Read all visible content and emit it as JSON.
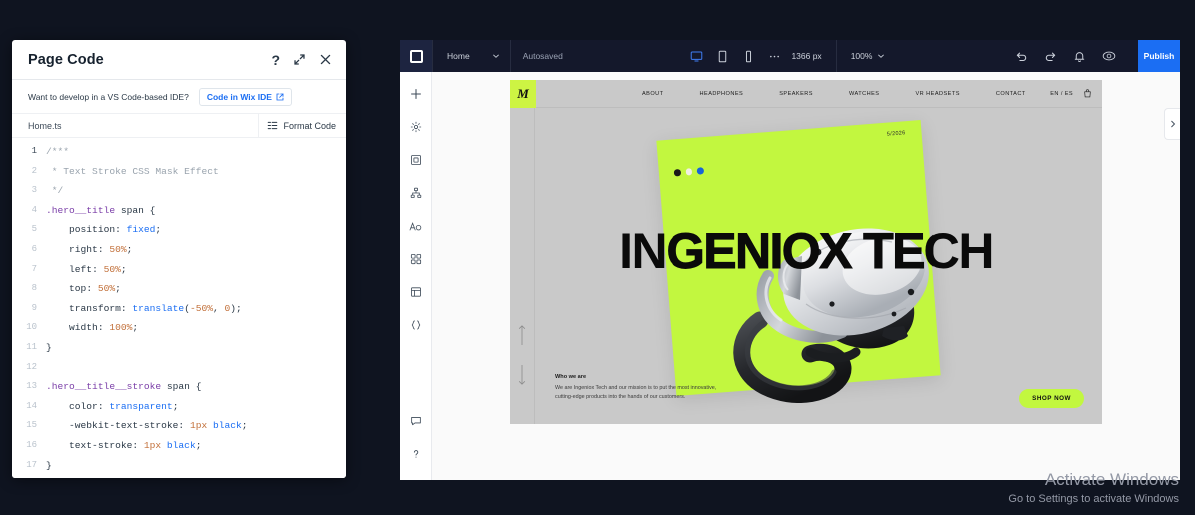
{
  "code_panel": {
    "title": "Page Code",
    "actions": [
      {
        "name": "help-icon",
        "label": "?"
      },
      {
        "name": "expand-icon",
        "label": "expand"
      },
      {
        "name": "close-icon",
        "label": "close"
      }
    ],
    "promo_text": "Want to develop in a VS Code-based IDE?",
    "ide_button_label": "Code in Wix IDE",
    "tab_label": "Home.ts",
    "format_label": "Format Code",
    "lines": [
      {
        "n": "1",
        "active": true,
        "tokens": [
          {
            "t": "/***",
            "c": "k-com"
          }
        ]
      },
      {
        "n": "2",
        "active": false,
        "tokens": [
          {
            "t": " * Text Stroke CSS Mask Effect",
            "c": "k-com"
          }
        ]
      },
      {
        "n": "3",
        "active": false,
        "tokens": [
          {
            "t": " */",
            "c": "k-com"
          }
        ]
      },
      {
        "n": "4",
        "active": false,
        "tokens": [
          {
            "t": ".hero__title",
            "c": "k-sel"
          },
          {
            "t": " span {",
            "c": "k-pun"
          }
        ]
      },
      {
        "n": "5",
        "active": false,
        "tokens": [
          {
            "t": "    position",
            "c": "k-prop"
          },
          {
            "t": ": ",
            "c": "k-pun"
          },
          {
            "t": "fixed",
            "c": "k-val"
          },
          {
            "t": ";",
            "c": "k-pun"
          }
        ]
      },
      {
        "n": "6",
        "active": false,
        "tokens": [
          {
            "t": "    right",
            "c": "k-prop"
          },
          {
            "t": ": ",
            "c": "k-pun"
          },
          {
            "t": "50%",
            "c": "k-num"
          },
          {
            "t": ";",
            "c": "k-pun"
          }
        ]
      },
      {
        "n": "7",
        "active": false,
        "tokens": [
          {
            "t": "    left",
            "c": "k-prop"
          },
          {
            "t": ": ",
            "c": "k-pun"
          },
          {
            "t": "50%",
            "c": "k-num"
          },
          {
            "t": ";",
            "c": "k-pun"
          }
        ]
      },
      {
        "n": "8",
        "active": false,
        "tokens": [
          {
            "t": "    top",
            "c": "k-prop"
          },
          {
            "t": ": ",
            "c": "k-pun"
          },
          {
            "t": "50%",
            "c": "k-num"
          },
          {
            "t": ";",
            "c": "k-pun"
          }
        ]
      },
      {
        "n": "9",
        "active": false,
        "tokens": [
          {
            "t": "    transform",
            "c": "k-prop"
          },
          {
            "t": ": ",
            "c": "k-pun"
          },
          {
            "t": "translate",
            "c": "k-val"
          },
          {
            "t": "(",
            "c": "k-pun"
          },
          {
            "t": "-50%",
            "c": "k-num"
          },
          {
            "t": ", ",
            "c": "k-pun"
          },
          {
            "t": "0",
            "c": "k-num"
          },
          {
            "t": ");",
            "c": "k-pun"
          }
        ]
      },
      {
        "n": "10",
        "active": false,
        "tokens": [
          {
            "t": "    width",
            "c": "k-prop"
          },
          {
            "t": ": ",
            "c": "k-pun"
          },
          {
            "t": "100%",
            "c": "k-num"
          },
          {
            "t": ";",
            "c": "k-pun"
          }
        ]
      },
      {
        "n": "11",
        "active": false,
        "tokens": [
          {
            "t": "}",
            "c": "k-pun"
          }
        ]
      },
      {
        "n": "12",
        "active": false,
        "tokens": [
          {
            "t": "",
            "c": "k-pun"
          }
        ]
      },
      {
        "n": "13",
        "active": false,
        "tokens": [
          {
            "t": ".hero__title__stroke",
            "c": "k-sel"
          },
          {
            "t": " span {",
            "c": "k-pun"
          }
        ]
      },
      {
        "n": "14",
        "active": false,
        "tokens": [
          {
            "t": "    color",
            "c": "k-prop"
          },
          {
            "t": ": ",
            "c": "k-pun"
          },
          {
            "t": "transparent",
            "c": "k-val"
          },
          {
            "t": ";",
            "c": "k-pun"
          }
        ]
      },
      {
        "n": "15",
        "active": false,
        "tokens": [
          {
            "t": "    -webkit-text-stroke",
            "c": "k-prop"
          },
          {
            "t": ": ",
            "c": "k-pun"
          },
          {
            "t": "1px",
            "c": "k-num"
          },
          {
            "t": " black",
            "c": "k-val"
          },
          {
            "t": ";",
            "c": "k-pun"
          }
        ]
      },
      {
        "n": "16",
        "active": false,
        "tokens": [
          {
            "t": "    text-stroke",
            "c": "k-prop"
          },
          {
            "t": ": ",
            "c": "k-pun"
          },
          {
            "t": "1px",
            "c": "k-num"
          },
          {
            "t": " black",
            "c": "k-val"
          },
          {
            "t": ";",
            "c": "k-pun"
          }
        ]
      },
      {
        "n": "17",
        "active": false,
        "tokens": [
          {
            "t": "}",
            "c": "k-pun"
          }
        ]
      }
    ]
  },
  "editor": {
    "logo_name": "wix-logo",
    "page_name": "Home",
    "save_status": "Autosaved",
    "viewport_width": "1366 px",
    "zoom_level": "100%",
    "publish_label": "Publish",
    "devices": [
      {
        "name": "desktop-view-icon",
        "active": true
      },
      {
        "name": "tablet-view-icon",
        "active": false
      },
      {
        "name": "mobile-view-icon",
        "active": false
      },
      {
        "name": "more-options-icon",
        "active": false
      }
    ],
    "right_icons": [
      {
        "name": "undo-icon"
      },
      {
        "name": "redo-icon"
      },
      {
        "name": "notifications-icon"
      },
      {
        "name": "preview-icon"
      }
    ],
    "sidebar": [
      {
        "name": "sidebar-add-icon",
        "label": "Add"
      },
      {
        "name": "sidebar-settings-icon",
        "label": "Settings"
      },
      {
        "name": "sidebar-pages-icon",
        "label": "Pages"
      },
      {
        "name": "sidebar-site-structure-icon",
        "label": "Site Structure"
      },
      {
        "name": "sidebar-text-theme-icon",
        "label": "Text & Theme"
      },
      {
        "name": "sidebar-apps-icon",
        "label": "Apps"
      },
      {
        "name": "sidebar-cms-icon",
        "label": "CMS"
      },
      {
        "name": "sidebar-dev-mode-icon",
        "label": "Dev Mode"
      }
    ],
    "sidebar_bottom": [
      {
        "name": "sidebar-chat-icon",
        "label": "Chat"
      },
      {
        "name": "sidebar-help-icon",
        "label": "Help"
      }
    ],
    "panel_toggle_name": "expand-right-panel-icon"
  },
  "site": {
    "logo_letter": "M",
    "nav_links": [
      "ABOUT",
      "HEADPHONES",
      "SPEAKERS",
      "WATCHES",
      "VR HEADSETS",
      "CONTACT"
    ],
    "language": "EN / ES",
    "cart_icon": "shopping-bag-icon",
    "card_date": "5/2026",
    "card_dots": [
      "#1a1a1a",
      "#f2f0e4",
      "#1864d8"
    ],
    "hero_title": "INGENIOX TECH",
    "about_heading": "Who we are",
    "about_body": "We are Ingeniox Tech and our mission is to put the most innovative, cutting-edge products into the hands of our customers.",
    "shop_now_label": "SHOP NOW",
    "accent_color": "#c2f73f",
    "background_color": "#c9c9c9"
  },
  "watermark": {
    "line1": "Activate Windows",
    "line2": "Go to Settings to activate Windows"
  }
}
